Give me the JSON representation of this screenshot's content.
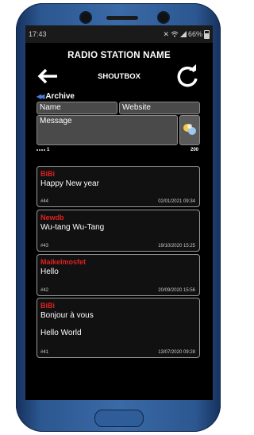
{
  "statusbar": {
    "time": "17:43",
    "battery": "66%",
    "icons": [
      "mute-icon",
      "wifi-icon",
      "signal-icon",
      "battery-icon"
    ]
  },
  "header": {
    "station": "RADIO STATION NAME",
    "section": "SHOUTBOX"
  },
  "archive": {
    "label": "Archive"
  },
  "form": {
    "name_placeholder": "Name",
    "website_placeholder": "Website",
    "message_placeholder": "Message",
    "count": "1",
    "max": "200"
  },
  "messages": [
    {
      "author": "BiBi",
      "lines": [
        "Happy New year"
      ],
      "id": "#44",
      "date": "02/01/2021 09:34"
    },
    {
      "author": "Newdb",
      "lines": [
        "Wu-tang Wu-Tang"
      ],
      "id": "#43",
      "date": "19/10/2020 15:25"
    },
    {
      "author": "Maikelmosfet",
      "lines": [
        "Hello"
      ],
      "id": "#42",
      "date": "20/09/2020 15:56"
    },
    {
      "author": "BiBi",
      "lines": [
        "Bonjour à vous",
        "Hello World"
      ],
      "id": "#41",
      "date": "13/07/2020 09:28"
    }
  ],
  "colors": {
    "author": "#e02020",
    "accent": "#4a7fd4",
    "background": "#000000",
    "frame": "#2c5790"
  }
}
